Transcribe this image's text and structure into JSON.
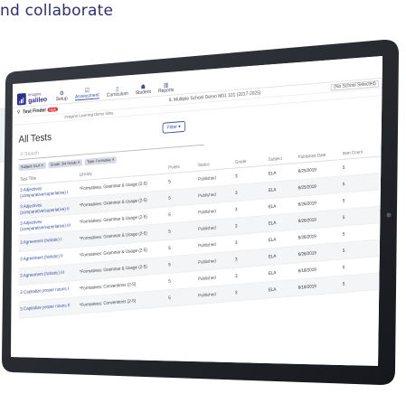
{
  "marketing": {
    "text": "nd collaborate"
  },
  "nav": {
    "logo_line1": "imagine",
    "logo_line2": "galileo",
    "items": [
      {
        "label": "Setup",
        "icon": "gear-icon",
        "glyph": "⚙"
      },
      {
        "label": "Assessment",
        "icon": "clipboard-icon",
        "glyph": "☑"
      },
      {
        "label": "Curriculum",
        "icon": "book-icon",
        "glyph": "▯"
      },
      {
        "label": "Student",
        "icon": "student-icon",
        "glyph": "☗"
      },
      {
        "label": "Reports",
        "icon": "chart-icon",
        "glyph": "▥"
      }
    ]
  },
  "subnav": {
    "test_finder": "Test Finder",
    "new_badge": "NEW",
    "district": "IL Multiple School Demo M01 101 (2017-2025)",
    "school": "(No School Selected)",
    "site": "Imagine Learning Demo Sites"
  },
  "main": {
    "title": "All Tests",
    "filter_label": "Filter",
    "search_placeholder": "Search",
    "chips": [
      "Subject: ELA",
      "Grade: 3rd Grade",
      "Type: Formative"
    ],
    "columns": [
      "Test Title",
      "Library",
      "Points",
      "Status",
      "Grade",
      "Subject",
      "Published Date",
      "Item Count"
    ],
    "rows": [
      {
        "title": "3 Adjectives (comparative/superlative) I",
        "library": "*Formatives: Grammar & Usage (2-5)",
        "points": "5",
        "status": "Published",
        "grade": "3",
        "subject": "ELA",
        "date": "6/25/2019",
        "count": "5"
      },
      {
        "title": "3 Adjectives (comparative/superlative) II",
        "library": "*Formatives: Grammar & Usage (2-5)",
        "points": "5",
        "status": "Published",
        "grade": "3",
        "subject": "ELA",
        "date": "6/25/2019",
        "count": "5"
      },
      {
        "title": "3 Adjectives (comparative/superlative) III",
        "library": "*Formatives: Grammar & Usage (2-5)",
        "points": "5",
        "status": "Published",
        "grade": "3",
        "subject": "ELA",
        "date": "6/26/2019",
        "count": "5"
      },
      {
        "title": "3 Agreement (holistic) I",
        "library": "*Formatives: Grammar & Usage (2-5)",
        "points": "5",
        "status": "Published",
        "grade": "3",
        "subject": "ELA",
        "date": "6/26/2019",
        "count": "5"
      },
      {
        "title": "3 Agreement (holistic) II",
        "library": "*Formatives: Grammar & Usage (2-5)",
        "points": "5",
        "status": "Published",
        "grade": "3",
        "subject": "ELA",
        "date": "6/26/2019",
        "count": "5"
      },
      {
        "title": "3 Agreement (holistic) III",
        "library": "*Formatives: Grammar & Usage (2-5)",
        "points": "5",
        "status": "Published",
        "grade": "3",
        "subject": "ELA",
        "date": "6/26/2019",
        "count": "5"
      },
      {
        "title": "3 Capitalize proper nouns I",
        "library": "*Formatives: Conventions (2-5)",
        "points": "5",
        "status": "Published",
        "grade": "3",
        "subject": "ELA",
        "date": "6/18/2019",
        "count": "5"
      },
      {
        "title": "3 Capitalize proper nouns II",
        "library": "*Formatives: Conventions (2-5)",
        "points": "5",
        "status": "Published",
        "grade": "3",
        "subject": "ELA",
        "date": "6/18/2019",
        "count": "5"
      }
    ]
  }
}
